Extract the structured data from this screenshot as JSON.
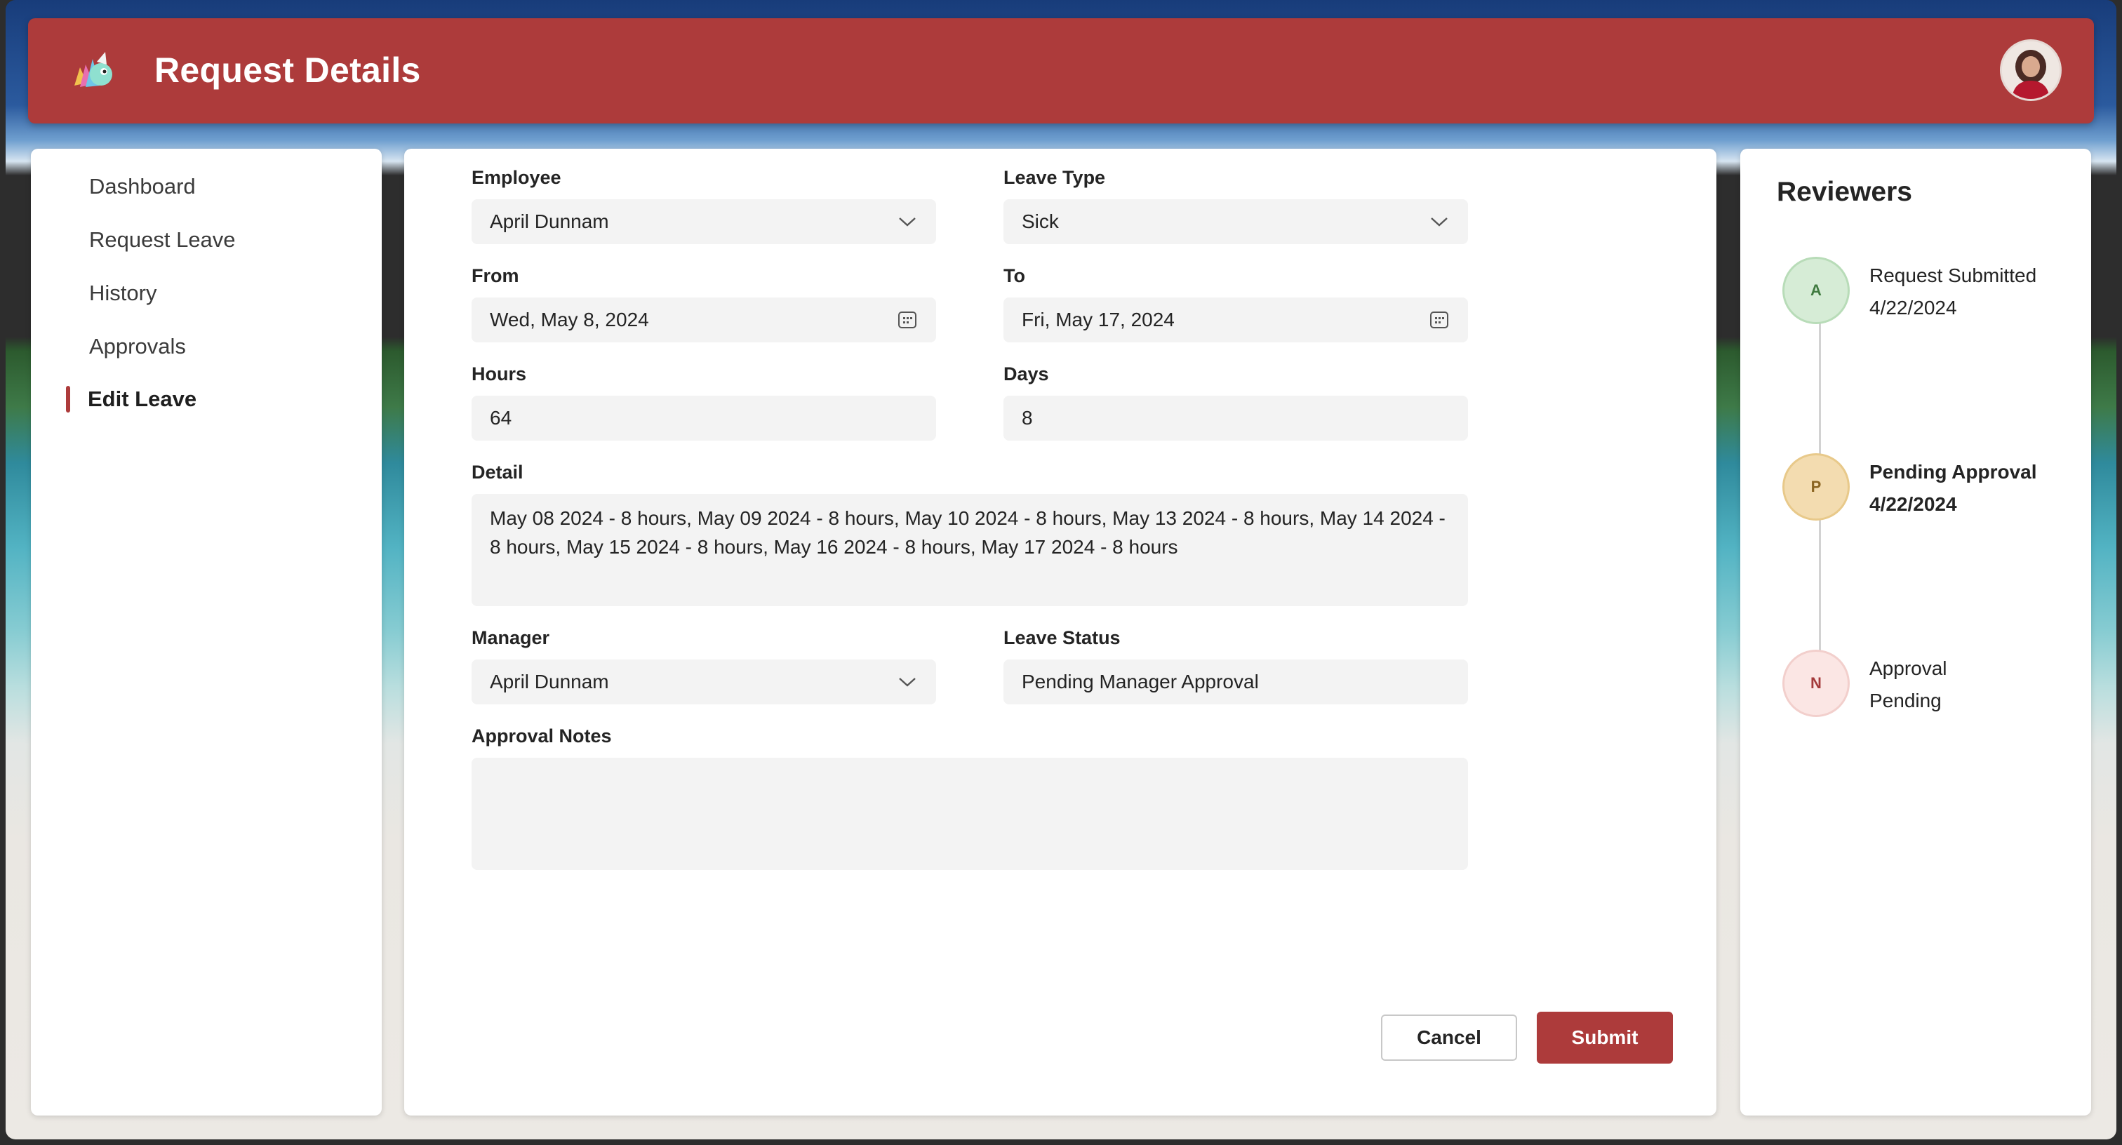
{
  "header": {
    "title": "Request Details",
    "logo_icon": "app-logo-icon",
    "avatar_icon": "user-avatar"
  },
  "nav": {
    "items": [
      {
        "label": "Dashboard"
      },
      {
        "label": "Request Leave"
      },
      {
        "label": "History"
      },
      {
        "label": "Approvals"
      },
      {
        "label": "Edit Leave",
        "active": true
      }
    ]
  },
  "form": {
    "employee": {
      "label": "Employee",
      "value": "April Dunnam"
    },
    "leave_type": {
      "label": "Leave Type",
      "value": "Sick"
    },
    "from": {
      "label": "From",
      "value": "Wed, May 8, 2024"
    },
    "to": {
      "label": "To",
      "value": "Fri, May 17, 2024"
    },
    "hours": {
      "label": "Hours",
      "value": "64"
    },
    "days": {
      "label": "Days",
      "value": "8"
    },
    "detail": {
      "label": "Detail",
      "value": "May 08 2024 - 8 hours, May 09 2024 - 8 hours, May 10 2024 - 8 hours, May 13 2024 - 8 hours, May 14 2024 - 8 hours, May 15 2024 - 8 hours, May 16 2024 - 8 hours, May 17 2024 - 8 hours"
    },
    "manager": {
      "label": "Manager",
      "value": "April Dunnam"
    },
    "leave_status": {
      "label": "Leave Status",
      "value": "Pending Manager Approval"
    },
    "approval_notes": {
      "label": "Approval Notes",
      "value": ""
    },
    "cancel_label": "Cancel",
    "submit_label": "Submit"
  },
  "reviewers": {
    "title": "Reviewers",
    "steps": [
      {
        "initial": "A",
        "line1": "Request Submitted",
        "line2": "4/22/2024",
        "color": "#6aa86a"
      },
      {
        "initial": "P",
        "line1": "Pending Approval",
        "line2": "4/22/2024",
        "color": "#c8a040"
      },
      {
        "initial": "N",
        "line1": "Approval",
        "line2": "Pending",
        "color": "#c04a4a"
      }
    ]
  },
  "colors": {
    "accent": "#ad3b3b",
    "field_bg": "#f3f3f3"
  }
}
